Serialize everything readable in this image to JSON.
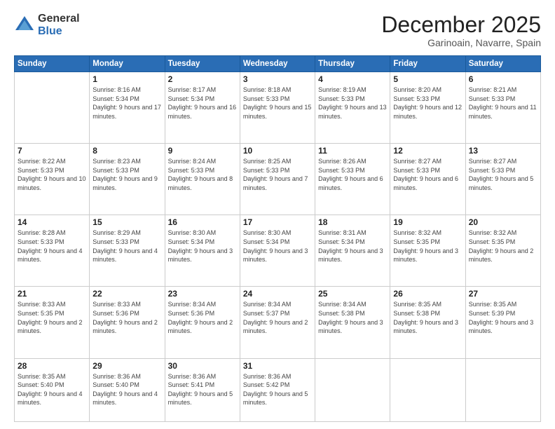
{
  "logo": {
    "general": "General",
    "blue": "Blue"
  },
  "header": {
    "month": "December 2025",
    "location": "Garinoain, Navarre, Spain"
  },
  "weekdays": [
    "Sunday",
    "Monday",
    "Tuesday",
    "Wednesday",
    "Thursday",
    "Friday",
    "Saturday"
  ],
  "weeks": [
    [
      {
        "day": "",
        "sunrise": "",
        "sunset": "",
        "daylight": ""
      },
      {
        "day": "1",
        "sunrise": "Sunrise: 8:16 AM",
        "sunset": "Sunset: 5:34 PM",
        "daylight": "Daylight: 9 hours and 17 minutes."
      },
      {
        "day": "2",
        "sunrise": "Sunrise: 8:17 AM",
        "sunset": "Sunset: 5:34 PM",
        "daylight": "Daylight: 9 hours and 16 minutes."
      },
      {
        "day": "3",
        "sunrise": "Sunrise: 8:18 AM",
        "sunset": "Sunset: 5:33 PM",
        "daylight": "Daylight: 9 hours and 15 minutes."
      },
      {
        "day": "4",
        "sunrise": "Sunrise: 8:19 AM",
        "sunset": "Sunset: 5:33 PM",
        "daylight": "Daylight: 9 hours and 13 minutes."
      },
      {
        "day": "5",
        "sunrise": "Sunrise: 8:20 AM",
        "sunset": "Sunset: 5:33 PM",
        "daylight": "Daylight: 9 hours and 12 minutes."
      },
      {
        "day": "6",
        "sunrise": "Sunrise: 8:21 AM",
        "sunset": "Sunset: 5:33 PM",
        "daylight": "Daylight: 9 hours and 11 minutes."
      }
    ],
    [
      {
        "day": "7",
        "sunrise": "Sunrise: 8:22 AM",
        "sunset": "Sunset: 5:33 PM",
        "daylight": "Daylight: 9 hours and 10 minutes."
      },
      {
        "day": "8",
        "sunrise": "Sunrise: 8:23 AM",
        "sunset": "Sunset: 5:33 PM",
        "daylight": "Daylight: 9 hours and 9 minutes."
      },
      {
        "day": "9",
        "sunrise": "Sunrise: 8:24 AM",
        "sunset": "Sunset: 5:33 PM",
        "daylight": "Daylight: 9 hours and 8 minutes."
      },
      {
        "day": "10",
        "sunrise": "Sunrise: 8:25 AM",
        "sunset": "Sunset: 5:33 PM",
        "daylight": "Daylight: 9 hours and 7 minutes."
      },
      {
        "day": "11",
        "sunrise": "Sunrise: 8:26 AM",
        "sunset": "Sunset: 5:33 PM",
        "daylight": "Daylight: 9 hours and 6 minutes."
      },
      {
        "day": "12",
        "sunrise": "Sunrise: 8:27 AM",
        "sunset": "Sunset: 5:33 PM",
        "daylight": "Daylight: 9 hours and 6 minutes."
      },
      {
        "day": "13",
        "sunrise": "Sunrise: 8:27 AM",
        "sunset": "Sunset: 5:33 PM",
        "daylight": "Daylight: 9 hours and 5 minutes."
      }
    ],
    [
      {
        "day": "14",
        "sunrise": "Sunrise: 8:28 AM",
        "sunset": "Sunset: 5:33 PM",
        "daylight": "Daylight: 9 hours and 4 minutes."
      },
      {
        "day": "15",
        "sunrise": "Sunrise: 8:29 AM",
        "sunset": "Sunset: 5:33 PM",
        "daylight": "Daylight: 9 hours and 4 minutes."
      },
      {
        "day": "16",
        "sunrise": "Sunrise: 8:30 AM",
        "sunset": "Sunset: 5:34 PM",
        "daylight": "Daylight: 9 hours and 3 minutes."
      },
      {
        "day": "17",
        "sunrise": "Sunrise: 8:30 AM",
        "sunset": "Sunset: 5:34 PM",
        "daylight": "Daylight: 9 hours and 3 minutes."
      },
      {
        "day": "18",
        "sunrise": "Sunrise: 8:31 AM",
        "sunset": "Sunset: 5:34 PM",
        "daylight": "Daylight: 9 hours and 3 minutes."
      },
      {
        "day": "19",
        "sunrise": "Sunrise: 8:32 AM",
        "sunset": "Sunset: 5:35 PM",
        "daylight": "Daylight: 9 hours and 3 minutes."
      },
      {
        "day": "20",
        "sunrise": "Sunrise: 8:32 AM",
        "sunset": "Sunset: 5:35 PM",
        "daylight": "Daylight: 9 hours and 2 minutes."
      }
    ],
    [
      {
        "day": "21",
        "sunrise": "Sunrise: 8:33 AM",
        "sunset": "Sunset: 5:35 PM",
        "daylight": "Daylight: 9 hours and 2 minutes."
      },
      {
        "day": "22",
        "sunrise": "Sunrise: 8:33 AM",
        "sunset": "Sunset: 5:36 PM",
        "daylight": "Daylight: 9 hours and 2 minutes."
      },
      {
        "day": "23",
        "sunrise": "Sunrise: 8:34 AM",
        "sunset": "Sunset: 5:36 PM",
        "daylight": "Daylight: 9 hours and 2 minutes."
      },
      {
        "day": "24",
        "sunrise": "Sunrise: 8:34 AM",
        "sunset": "Sunset: 5:37 PM",
        "daylight": "Daylight: 9 hours and 2 minutes."
      },
      {
        "day": "25",
        "sunrise": "Sunrise: 8:34 AM",
        "sunset": "Sunset: 5:38 PM",
        "daylight": "Daylight: 9 hours and 3 minutes."
      },
      {
        "day": "26",
        "sunrise": "Sunrise: 8:35 AM",
        "sunset": "Sunset: 5:38 PM",
        "daylight": "Daylight: 9 hours and 3 minutes."
      },
      {
        "day": "27",
        "sunrise": "Sunrise: 8:35 AM",
        "sunset": "Sunset: 5:39 PM",
        "daylight": "Daylight: 9 hours and 3 minutes."
      }
    ],
    [
      {
        "day": "28",
        "sunrise": "Sunrise: 8:35 AM",
        "sunset": "Sunset: 5:40 PM",
        "daylight": "Daylight: 9 hours and 4 minutes."
      },
      {
        "day": "29",
        "sunrise": "Sunrise: 8:36 AM",
        "sunset": "Sunset: 5:40 PM",
        "daylight": "Daylight: 9 hours and 4 minutes."
      },
      {
        "day": "30",
        "sunrise": "Sunrise: 8:36 AM",
        "sunset": "Sunset: 5:41 PM",
        "daylight": "Daylight: 9 hours and 5 minutes."
      },
      {
        "day": "31",
        "sunrise": "Sunrise: 8:36 AM",
        "sunset": "Sunset: 5:42 PM",
        "daylight": "Daylight: 9 hours and 5 minutes."
      },
      {
        "day": "",
        "sunrise": "",
        "sunset": "",
        "daylight": ""
      },
      {
        "day": "",
        "sunrise": "",
        "sunset": "",
        "daylight": ""
      },
      {
        "day": "",
        "sunrise": "",
        "sunset": "",
        "daylight": ""
      }
    ]
  ]
}
